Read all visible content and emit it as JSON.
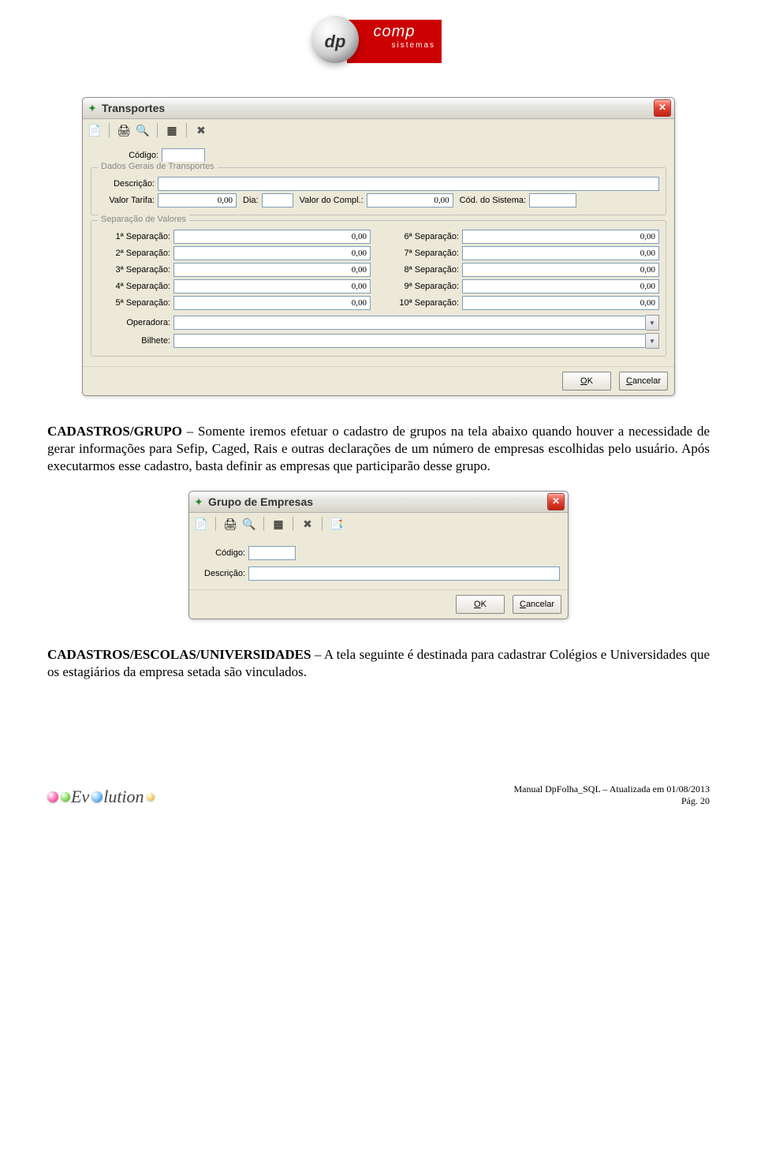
{
  "logo_header": {
    "dp": "dp",
    "comp": "comp",
    "sub": "sistemas"
  },
  "win1": {
    "title": "Transportes",
    "codigo_label": "Código:",
    "grp1_legend": "Dados Gerais de Transportes",
    "desc_label": "Descrição:",
    "tarifa_label": "Valor Tarifa:",
    "tarifa_value": "0,00",
    "dia_label": "Dia:",
    "dia_value": "",
    "compl_label": "Valor do Compl.:",
    "compl_value": "0,00",
    "codsist_label": "Cód. do Sistema:",
    "codsist_value": "",
    "grp2_legend": "Separação de Valores",
    "sep": [
      {
        "label": "1ª Separação:",
        "value": "0,00"
      },
      {
        "label": "2ª Separação:",
        "value": "0,00"
      },
      {
        "label": "3ª Separação:",
        "value": "0,00"
      },
      {
        "label": "4ª Separação:",
        "value": "0,00"
      },
      {
        "label": "5ª Separação:",
        "value": "0,00"
      },
      {
        "label": "6ª Separação:",
        "value": "0,00"
      },
      {
        "label": "7ª Separação:",
        "value": "0,00"
      },
      {
        "label": "8ª Separação:",
        "value": "0,00"
      },
      {
        "label": "9ª Separação:",
        "value": "0,00"
      },
      {
        "label": "10ª Separação:",
        "value": "0,00"
      }
    ],
    "operadora_label": "Operadora:",
    "bilhete_label": "Bilhete:",
    "ok": "OK",
    "cancel": "Cancelar"
  },
  "para1": {
    "title": "CADASTROS/GRUPO",
    "text": " – Somente iremos efetuar o cadastro de grupos na tela abaixo quando houver a necessidade de gerar informações para Sefip, Caged, Rais e outras declarações de um número de empresas escolhidas pelo usuário. Após executarmos esse cadastro, basta definir as empresas que participarão desse grupo."
  },
  "win2": {
    "title": "Grupo de Empresas",
    "codigo_label": "Código:",
    "desc_label": "Descrição:",
    "ok": "OK",
    "cancel": "Cancelar"
  },
  "para2": {
    "title": "CADASTROS/ESCOLAS/UNIVERSIDADES",
    "text": " – A tela seguinte é destinada para cadastrar Colégios e Universidades que os estagiários da empresa setada são vinculados."
  },
  "footer": {
    "line1": "Manual DpFolha_SQL – Atualizada em 01/08/2013",
    "line2": "Pág. 20",
    "ev": "lution"
  }
}
